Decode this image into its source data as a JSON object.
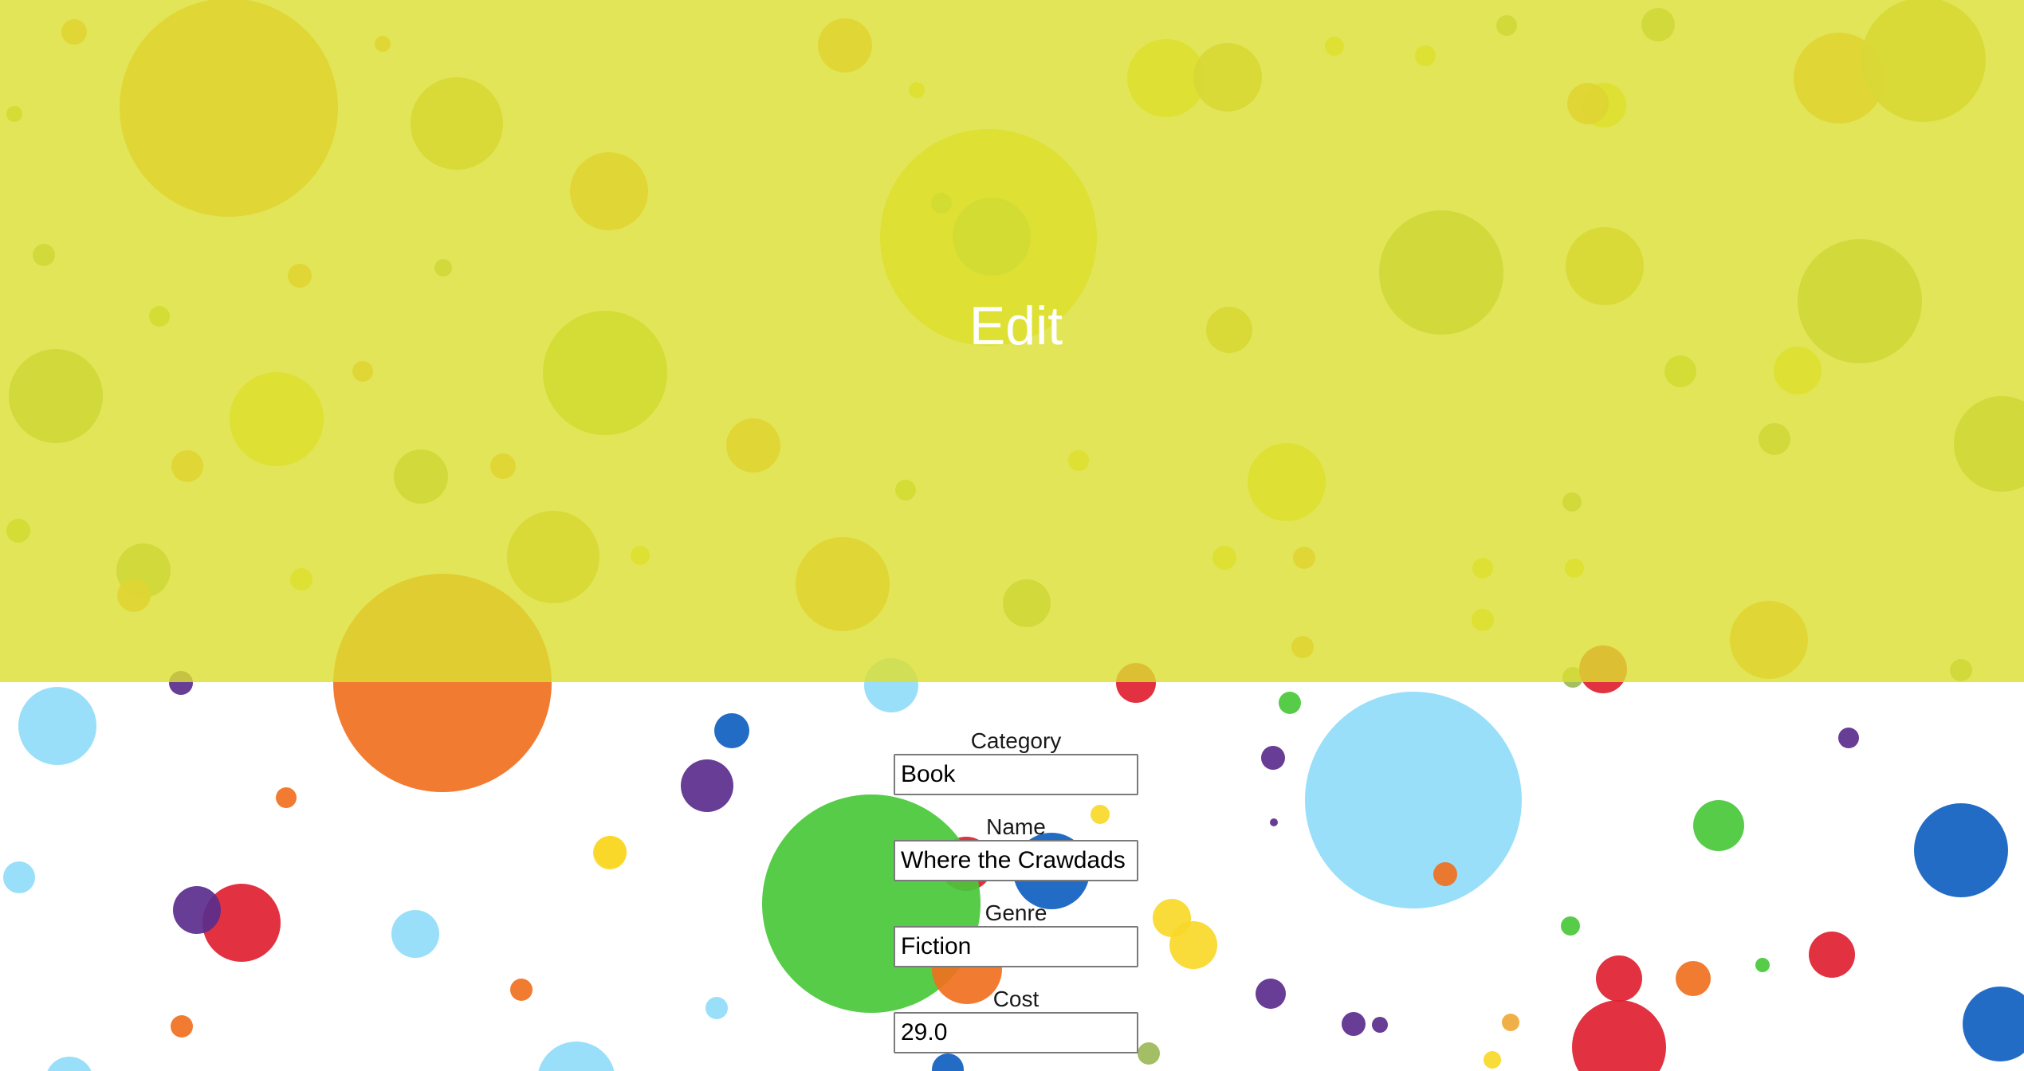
{
  "header": {
    "title": "Edit",
    "overlay_color": "#dcdf32"
  },
  "background": {
    "pattern": "confetti-dots",
    "colors": [
      "#f0a838",
      "#c8b848",
      "#e8e030",
      "#a8c838",
      "#9bb858",
      "#f07020",
      "#e02030",
      "#5a2d8c",
      "#1060c0",
      "#48c838",
      "#90dcf8",
      "#f8d828"
    ]
  },
  "form": {
    "fields": [
      {
        "label": "Category",
        "value": "Book"
      },
      {
        "label": "Name",
        "value": "Where the Crawdads Sing"
      },
      {
        "label": "Genre",
        "value": "Fiction"
      },
      {
        "label": "Cost",
        "value": "29.0"
      }
    ]
  }
}
